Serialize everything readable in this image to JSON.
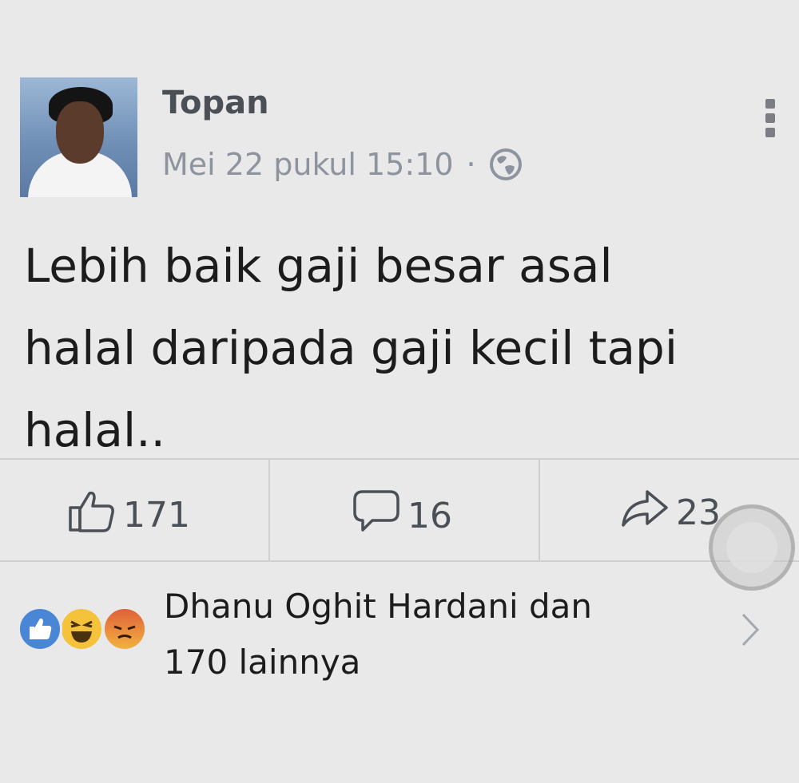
{
  "post": {
    "author": "Topan",
    "timestamp": "Mei 22 pukul 15:10",
    "separator": "·",
    "privacy_icon": "globe-icon",
    "text": "Lebih baik gaji besar asal\nhalal daripada gaji kecil tapi\nhalal..",
    "menu_icon": "more-options-icon"
  },
  "stats": {
    "likes": "171",
    "comments": "16",
    "shares": "23"
  },
  "reactions": {
    "icons": [
      "like-icon",
      "haha-icon",
      "angry-icon"
    ],
    "summary_line1": "Dhanu Oghit Hardani dan",
    "summary_line2": "170 lainnya"
  },
  "colors": {
    "background": "#e9e9e9",
    "author": "#4b4f56",
    "meta": "#8d949e",
    "like_blue": "#4a86d6"
  }
}
